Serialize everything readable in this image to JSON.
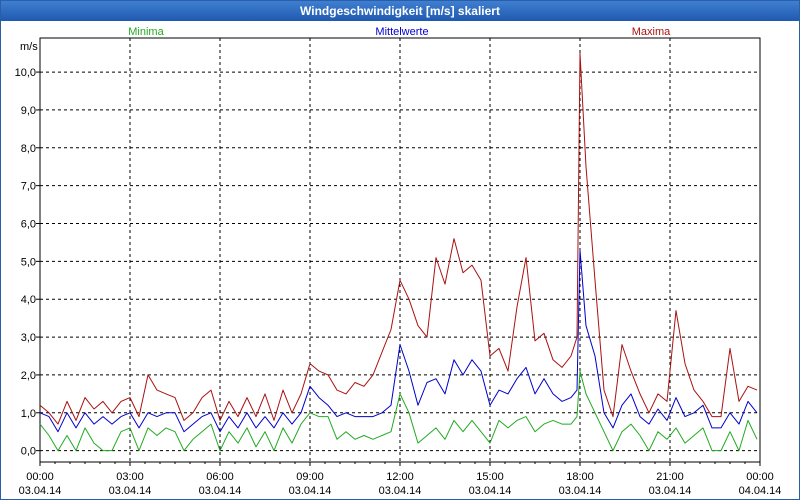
{
  "window": {
    "title": "Windgeschwindigkeit [m/s] skaliert"
  },
  "chart_data": {
    "type": "line",
    "title": "Windgeschwindigkeit [m/s] skaliert",
    "ylabel": "m/s",
    "ylim": [
      -0.3,
      10.9
    ],
    "xlim_hours": [
      0,
      24
    ],
    "grid": true,
    "y_ticks": [
      "0,0",
      "1,0",
      "2,0",
      "3,0",
      "4,0",
      "5,0",
      "6,0",
      "7,0",
      "8,0",
      "9,0",
      "10,0"
    ],
    "x_ticks": [
      {
        "time": "00:00",
        "date": "03.04.14"
      },
      {
        "time": "03:00",
        "date": "03.04.14"
      },
      {
        "time": "06:00",
        "date": "03.04.14"
      },
      {
        "time": "09:00",
        "date": "03.04.14"
      },
      {
        "time": "12:00",
        "date": "03.04.14"
      },
      {
        "time": "15:00",
        "date": "03.04.14"
      },
      {
        "time": "18:00",
        "date": "03.04.14"
      },
      {
        "time": "21:00",
        "date": "03.04.14"
      },
      {
        "time": "00:00",
        "date": "04.04.14"
      }
    ],
    "legend": [
      "Minima",
      "Mittelwerte",
      "Maxima"
    ],
    "series": [
      {
        "name": "Minima",
        "color": "#22aa22",
        "points": [
          [
            0,
            0.7
          ],
          [
            0.3,
            0.4
          ],
          [
            0.6,
            0.0
          ],
          [
            0.9,
            0.4
          ],
          [
            1.2,
            0.0
          ],
          [
            1.5,
            0.6
          ],
          [
            1.8,
            0.2
          ],
          [
            2.1,
            0.0
          ],
          [
            2.4,
            0.0
          ],
          [
            2.7,
            0.5
          ],
          [
            3.0,
            0.6
          ],
          [
            3.3,
            0.0
          ],
          [
            3.6,
            0.6
          ],
          [
            3.9,
            0.4
          ],
          [
            4.2,
            0.6
          ],
          [
            4.5,
            0.5
          ],
          [
            4.8,
            0.0
          ],
          [
            5.1,
            0.3
          ],
          [
            5.4,
            0.5
          ],
          [
            5.7,
            0.7
          ],
          [
            6.0,
            0.0
          ],
          [
            6.3,
            0.5
          ],
          [
            6.6,
            0.2
          ],
          [
            6.9,
            0.6
          ],
          [
            7.2,
            0.1
          ],
          [
            7.5,
            0.5
          ],
          [
            7.8,
            0.0
          ],
          [
            8.1,
            0.6
          ],
          [
            8.4,
            0.2
          ],
          [
            8.7,
            0.7
          ],
          [
            9.0,
            1.0
          ],
          [
            9.3,
            0.9
          ],
          [
            9.6,
            0.9
          ],
          [
            9.9,
            0.3
          ],
          [
            10.2,
            0.5
          ],
          [
            10.5,
            0.3
          ],
          [
            10.8,
            0.4
          ],
          [
            11.1,
            0.3
          ],
          [
            11.4,
            0.4
          ],
          [
            11.7,
            0.5
          ],
          [
            12.0,
            1.5
          ],
          [
            12.3,
            1.0
          ],
          [
            12.6,
            0.2
          ],
          [
            12.9,
            0.4
          ],
          [
            13.2,
            0.6
          ],
          [
            13.5,
            0.3
          ],
          [
            13.8,
            0.8
          ],
          [
            14.1,
            0.5
          ],
          [
            14.4,
            0.8
          ],
          [
            14.7,
            0.5
          ],
          [
            15.0,
            0.2
          ],
          [
            15.3,
            0.8
          ],
          [
            15.6,
            0.6
          ],
          [
            15.9,
            0.8
          ],
          [
            16.2,
            0.9
          ],
          [
            16.5,
            0.5
          ],
          [
            16.8,
            0.7
          ],
          [
            17.1,
            0.8
          ],
          [
            17.4,
            0.7
          ],
          [
            17.7,
            0.7
          ],
          [
            17.9,
            0.9
          ],
          [
            18.0,
            2.1
          ],
          [
            18.2,
            1.5
          ],
          [
            18.5,
            1.0
          ],
          [
            18.8,
            0.5
          ],
          [
            19.1,
            0.0
          ],
          [
            19.4,
            0.5
          ],
          [
            19.7,
            0.7
          ],
          [
            20.0,
            0.4
          ],
          [
            20.3,
            0.0
          ],
          [
            20.6,
            0.5
          ],
          [
            20.9,
            0.3
          ],
          [
            21.2,
            0.6
          ],
          [
            21.5,
            0.2
          ],
          [
            21.8,
            0.4
          ],
          [
            22.1,
            0.6
          ],
          [
            22.4,
            0.0
          ],
          [
            22.7,
            0.0
          ],
          [
            23.0,
            0.5
          ],
          [
            23.3,
            0.0
          ],
          [
            23.6,
            0.8
          ],
          [
            23.9,
            0.3
          ]
        ]
      },
      {
        "name": "Mittelwerte",
        "color": "#0000cc",
        "points": [
          [
            0,
            1.0
          ],
          [
            0.3,
            0.9
          ],
          [
            0.6,
            0.5
          ],
          [
            0.9,
            1.0
          ],
          [
            1.2,
            0.6
          ],
          [
            1.5,
            1.0
          ],
          [
            1.8,
            0.7
          ],
          [
            2.1,
            0.9
          ],
          [
            2.4,
            0.7
          ],
          [
            2.7,
            0.9
          ],
          [
            3.0,
            1.0
          ],
          [
            3.3,
            0.6
          ],
          [
            3.6,
            1.0
          ],
          [
            3.9,
            0.9
          ],
          [
            4.2,
            1.0
          ],
          [
            4.5,
            1.0
          ],
          [
            4.8,
            0.5
          ],
          [
            5.1,
            0.7
          ],
          [
            5.4,
            0.9
          ],
          [
            5.7,
            1.0
          ],
          [
            6.0,
            0.5
          ],
          [
            6.3,
            0.9
          ],
          [
            6.6,
            0.6
          ],
          [
            6.9,
            1.0
          ],
          [
            7.2,
            0.6
          ],
          [
            7.5,
            0.9
          ],
          [
            7.8,
            0.6
          ],
          [
            8.1,
            1.0
          ],
          [
            8.4,
            0.7
          ],
          [
            8.7,
            1.0
          ],
          [
            9.0,
            1.7
          ],
          [
            9.3,
            1.4
          ],
          [
            9.6,
            1.2
          ],
          [
            9.9,
            0.9
          ],
          [
            10.2,
            1.0
          ],
          [
            10.5,
            0.9
          ],
          [
            10.8,
            0.9
          ],
          [
            11.1,
            0.9
          ],
          [
            11.4,
            1.0
          ],
          [
            11.7,
            1.2
          ],
          [
            12.0,
            2.8
          ],
          [
            12.3,
            2.1
          ],
          [
            12.6,
            1.2
          ],
          [
            12.9,
            1.8
          ],
          [
            13.2,
            1.9
          ],
          [
            13.5,
            1.5
          ],
          [
            13.8,
            2.4
          ],
          [
            14.1,
            2.0
          ],
          [
            14.4,
            2.4
          ],
          [
            14.7,
            2.1
          ],
          [
            15.0,
            1.2
          ],
          [
            15.3,
            1.6
          ],
          [
            15.6,
            1.5
          ],
          [
            15.9,
            1.9
          ],
          [
            16.2,
            2.2
          ],
          [
            16.5,
            1.5
          ],
          [
            16.8,
            1.9
          ],
          [
            17.1,
            1.5
          ],
          [
            17.4,
            1.3
          ],
          [
            17.7,
            1.4
          ],
          [
            17.9,
            1.6
          ],
          [
            18.0,
            5.3
          ],
          [
            18.2,
            3.3
          ],
          [
            18.5,
            2.5
          ],
          [
            18.8,
            1.0
          ],
          [
            19.1,
            0.6
          ],
          [
            19.4,
            1.2
          ],
          [
            19.7,
            1.5
          ],
          [
            20.0,
            0.9
          ],
          [
            20.3,
            0.7
          ],
          [
            20.6,
            1.1
          ],
          [
            20.9,
            0.8
          ],
          [
            21.2,
            1.4
          ],
          [
            21.5,
            0.9
          ],
          [
            21.8,
            1.0
          ],
          [
            22.1,
            1.2
          ],
          [
            22.4,
            0.6
          ],
          [
            22.7,
            0.6
          ],
          [
            23.0,
            1.0
          ],
          [
            23.3,
            0.7
          ],
          [
            23.6,
            1.3
          ],
          [
            23.9,
            1.0
          ]
        ]
      },
      {
        "name": "Maxima",
        "color": "#aa1111",
        "points": [
          [
            0,
            1.2
          ],
          [
            0.3,
            1.0
          ],
          [
            0.6,
            0.7
          ],
          [
            0.9,
            1.3
          ],
          [
            1.2,
            0.8
          ],
          [
            1.5,
            1.4
          ],
          [
            1.8,
            1.1
          ],
          [
            2.1,
            1.3
          ],
          [
            2.4,
            1.0
          ],
          [
            2.7,
            1.3
          ],
          [
            3.0,
            1.4
          ],
          [
            3.3,
            0.9
          ],
          [
            3.6,
            2.0
          ],
          [
            3.9,
            1.6
          ],
          [
            4.2,
            1.5
          ],
          [
            4.5,
            1.4
          ],
          [
            4.8,
            0.8
          ],
          [
            5.1,
            1.0
          ],
          [
            5.4,
            1.4
          ],
          [
            5.7,
            1.6
          ],
          [
            6.0,
            0.8
          ],
          [
            6.3,
            1.3
          ],
          [
            6.6,
            0.9
          ],
          [
            6.9,
            1.4
          ],
          [
            7.2,
            0.9
          ],
          [
            7.5,
            1.5
          ],
          [
            7.8,
            0.8
          ],
          [
            8.1,
            1.6
          ],
          [
            8.4,
            1.0
          ],
          [
            8.7,
            1.5
          ],
          [
            9.0,
            2.3
          ],
          [
            9.3,
            2.1
          ],
          [
            9.6,
            2.0
          ],
          [
            9.9,
            1.6
          ],
          [
            10.2,
            1.5
          ],
          [
            10.5,
            1.8
          ],
          [
            10.8,
            1.7
          ],
          [
            11.1,
            2.0
          ],
          [
            11.4,
            2.6
          ],
          [
            11.7,
            3.2
          ],
          [
            12.0,
            4.5
          ],
          [
            12.3,
            4.0
          ],
          [
            12.6,
            3.3
          ],
          [
            12.9,
            3.0
          ],
          [
            13.2,
            5.1
          ],
          [
            13.5,
            4.4
          ],
          [
            13.8,
            5.6
          ],
          [
            14.1,
            4.7
          ],
          [
            14.4,
            4.9
          ],
          [
            14.7,
            4.5
          ],
          [
            15.0,
            2.5
          ],
          [
            15.3,
            2.7
          ],
          [
            15.6,
            2.1
          ],
          [
            15.9,
            3.8
          ],
          [
            16.2,
            5.1
          ],
          [
            16.5,
            2.9
          ],
          [
            16.8,
            3.1
          ],
          [
            17.1,
            2.4
          ],
          [
            17.4,
            2.2
          ],
          [
            17.7,
            2.5
          ],
          [
            17.9,
            3.0
          ],
          [
            18.0,
            10.5
          ],
          [
            18.2,
            7.5
          ],
          [
            18.5,
            4.5
          ],
          [
            18.8,
            1.6
          ],
          [
            19.1,
            0.9
          ],
          [
            19.4,
            2.8
          ],
          [
            19.7,
            2.1
          ],
          [
            20.0,
            1.5
          ],
          [
            20.3,
            1.0
          ],
          [
            20.6,
            1.5
          ],
          [
            20.9,
            1.3
          ],
          [
            21.2,
            3.7
          ],
          [
            21.5,
            2.3
          ],
          [
            21.8,
            1.6
          ],
          [
            22.1,
            1.3
          ],
          [
            22.4,
            0.9
          ],
          [
            22.7,
            0.9
          ],
          [
            23.0,
            2.7
          ],
          [
            23.3,
            1.3
          ],
          [
            23.6,
            1.7
          ],
          [
            23.9,
            1.6
          ]
        ]
      }
    ]
  }
}
